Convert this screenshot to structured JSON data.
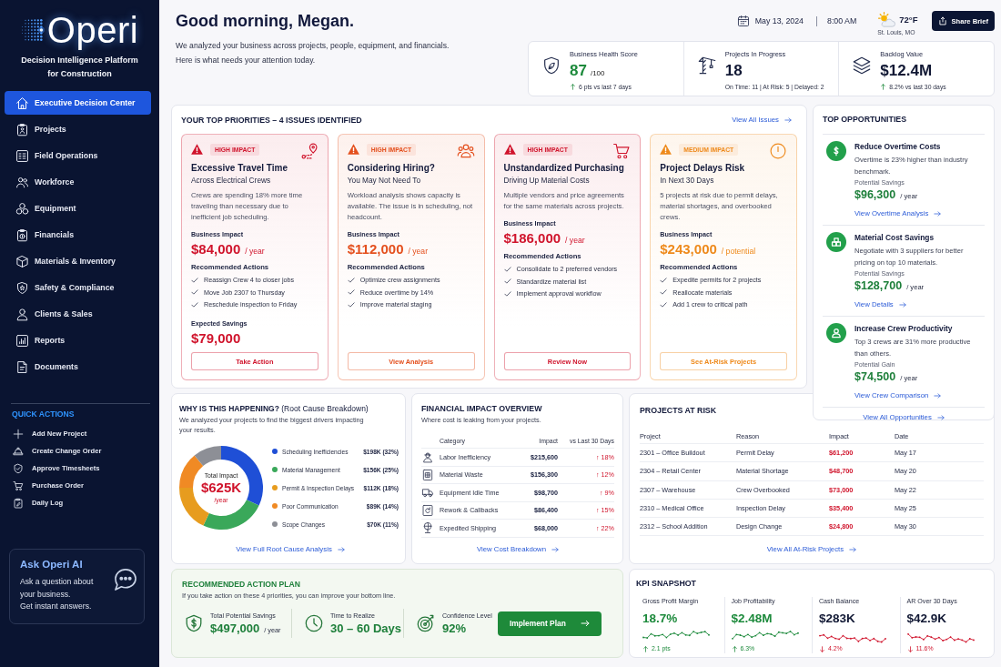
{
  "sidebar": {
    "brand": "Operi",
    "tagline": "Decision Intelligence Platform for Construction",
    "nav": [
      {
        "label": "Executive Decision Center",
        "selected": true
      },
      {
        "label": "Projects",
        "selected": false
      },
      {
        "label": "Field Operations",
        "selected": false
      },
      {
        "label": "Workforce",
        "selected": false
      },
      {
        "label": "Equipment",
        "selected": false
      },
      {
        "label": "Financials",
        "selected": false
      },
      {
        "label": "Materials & Inventory",
        "selected": false
      },
      {
        "label": "Safety & Compliance",
        "selected": false
      },
      {
        "label": "Clients & Sales",
        "selected": false
      },
      {
        "label": "Reports",
        "selected": false
      },
      {
        "label": "Documents",
        "selected": false
      }
    ],
    "quick_actions_title": "QUICK ACTIONS",
    "quick_actions": [
      "Add New Project",
      "Create Change Order",
      "Approve Timesheets",
      "Purchase Order",
      "Daily Log"
    ],
    "assistant": {
      "title": "Ask Operi AI",
      "text": "Ask a question about your business.",
      "subtext": "Get instant answers."
    }
  },
  "header": {
    "greeting": "Good morning, Megan.",
    "intro": [
      "We analyzed your business across projects, people, equipment, and financials.",
      "Here is what needs your attention today."
    ],
    "date": "May 13, 2024",
    "time": "8:00 AM",
    "weather": {
      "temperature": "72°F",
      "location": "St. Louis, MO"
    },
    "share_button": "Share Brief"
  },
  "summary": [
    {
      "label": "Business Health Score",
      "value": "87",
      "unit": "/100",
      "highlight": true,
      "rising": true,
      "note": "6 pts vs last 7 days"
    },
    {
      "label": "Projects In Progress",
      "value": "18",
      "highlight": false,
      "note": "On Time: 11 | At Risk: 5 | Delayed: 2"
    },
    {
      "label": "Backlog Value",
      "value": "$12.4M",
      "highlight": false,
      "rising": true,
      "note": "8.2% vs last 30 days"
    }
  ],
  "priorities": {
    "title": "YOUR TOP PRIORITIES – 4 ISSUES IDENTIFIED",
    "link": "View All Issues",
    "cards": [
      {
        "impact": "HIGH IMPACT",
        "color": "#d0142c",
        "title": "Excessive Travel Time",
        "subtitle": "Across Electrical Crews",
        "description": "Crews are spending 18% more time traveling than necessary due to inefficient job scheduling.",
        "impact_label": "Business Impact",
        "amount": "$84,000",
        "period": "/ year",
        "actions_title": "Recommended Actions",
        "actions": [
          "Reassign Crew 4 to closer jobs",
          "Move Job 2307 to Thursday",
          "Reschedule inspection to Friday"
        ],
        "savings": {
          "label": "Expected Savings",
          "amount": "$79,000"
        },
        "button": "Take Action"
      },
      {
        "impact": "HIGH IMPACT",
        "color": "#e4501e",
        "title": "Considering Hiring?",
        "subtitle": "You May Not Need To",
        "description": "Workload analysis shows capacity is available. The issue is in scheduling, not headcount.",
        "impact_label": "Business Impact",
        "amount": "$112,000",
        "period": "/ year",
        "actions_title": "Recommended Actions",
        "actions": [
          "Optimize crew assignments",
          "Reduce overtime by 14%",
          "Improve material staging"
        ],
        "button": "View Analysis"
      },
      {
        "impact": "HIGH IMPACT",
        "color": "#d0142c",
        "title": "Unstandardized Purchasing",
        "subtitle": "Driving Up Material Costs",
        "description": "Multiple vendors and price agreements for the same materials across projects.",
        "impact_label": "Business Impact",
        "amount": "$186,000",
        "period": "/ year",
        "actions_title": "Recommended Actions",
        "actions": [
          "Consolidate to 2 preferred vendors",
          "Standardize material list",
          "Implement approval workflow"
        ],
        "button": "Review Now"
      },
      {
        "impact": "MEDIUM IMPACT",
        "color": "#ee8a1c",
        "title": "Project Delays Risk",
        "subtitle": "In Next 30 Days",
        "description": "5 projects at risk due to permit delays, material shortages, and overbooked crews.",
        "impact_label": "Business Impact",
        "amount": "$243,000",
        "period": "/ potential",
        "actions_title": "Recommended Actions",
        "actions": [
          "Expedite permits for 2 projects",
          "Reallocate materials",
          "Add 1 crew to critical path"
        ],
        "button": "See At-Risk Projects"
      }
    ]
  },
  "opportunities": {
    "title": "TOP OPPORTUNITIES",
    "items": [
      {
        "title": "Reduce Overtime Costs",
        "description": "Overtime is 23% higher than industry benchmark.",
        "metric_label": "Potential Savings",
        "amount": "$96,300",
        "period": "/ year",
        "link": "View Overtime Analysis"
      },
      {
        "title": "Material Cost Savings",
        "description": "Negotiate with 3 suppliers for better pricing on top 10 materials.",
        "metric_label": "Potential Savings",
        "amount": "$128,700",
        "period": "/ year",
        "link": "View Details"
      },
      {
        "title": "Increase Crew Productivity",
        "description": "Top 3 crews are 31% more productive than others.",
        "metric_label": "Potential Gain",
        "amount": "$74,500",
        "period": "/ year",
        "link": "View Crew Comparison"
      }
    ],
    "link": "View All Opportunities"
  },
  "root_cause": {
    "title": "**WHY IS THIS HAPPENING?** (Root Cause Breakdown)",
    "description": "We analyzed your projects to find the biggest drivers impacting your results.",
    "total": {
      "label": "Total Impact",
      "value": "$625K",
      "unit": "/year"
    },
    "chart_data": {
      "type": "donut",
      "categories": [
        "Scheduling Inefficiencies",
        "Material Management",
        "Permit & Inspection Delays",
        "Poor Communication",
        "Scope Changes"
      ],
      "values": [
        32,
        25,
        18,
        14,
        11
      ],
      "colors": [
        "#1f4fd6",
        "#3aa85a",
        "#e79c1e",
        "#f08a24",
        "#8d8f96"
      ],
      "value_labels": [
        "$198K (32%)",
        "$156K (25%)",
        "$112K (18%)",
        "$89K (14%)",
        "$70K (11%)"
      ],
      "legend": "right"
    },
    "link": "View Full Root Cause Analysis"
  },
  "financial_impact": {
    "title": "FINANCIAL IMPACT OVERVIEW",
    "description": "Where cost is leaking from your projects.",
    "columns": [
      "Category",
      "Impact",
      "vs Last 30 Days"
    ],
    "rows": [
      {
        "category": "Labor Inefficiency",
        "impact": "$215,600",
        "change": "↑ 18%"
      },
      {
        "category": "Material Waste",
        "impact": "$156,300",
        "change": "↑ 12%"
      },
      {
        "category": "Equipment Idle Time",
        "impact": "$98,700",
        "change": "↑ 9%"
      },
      {
        "category": "Rework & Callbacks",
        "impact": "$86,400",
        "change": "↑ 15%"
      },
      {
        "category": "Expedited Shipping",
        "impact": "$68,000",
        "change": "↑ 22%"
      }
    ],
    "link": "View Cost Breakdown"
  },
  "projects_at_risk": {
    "title": "PROJECTS AT RISK",
    "columns": [
      "Project",
      "Reason",
      "Impact",
      "Date"
    ],
    "rows": [
      [
        "2301 – Office Buildout",
        "Permit Delay",
        "$61,200",
        "May 17"
      ],
      [
        "2304 – Retail Center",
        "Material Shortage",
        "$48,700",
        "May 20"
      ],
      [
        "2307 – Warehouse",
        "Crew Overbooked",
        "$73,000",
        "May 22"
      ],
      [
        "2310 – Medical Office",
        "Inspection Delay",
        "$35,400",
        "May 25"
      ],
      [
        "2312 – School Addition",
        "Design Change",
        "$24,800",
        "May 30"
      ]
    ],
    "link": "View All At-Risk Projects"
  },
  "action_plan": {
    "title": "RECOMMENDED ACTION PLAN",
    "description": "If you take action on these 4 priorities, you can improve your bottom line.",
    "metrics": [
      {
        "label": "Total Potential Savings",
        "value": "$497,000",
        "unit": "/ year"
      },
      {
        "label": "Time to Realize",
        "value": "30 – 60 Days"
      },
      {
        "label": "Confidence Level",
        "value": "92%"
      }
    ],
    "button": "Implement Plan"
  },
  "kpi_snapshot": {
    "title": "KPI SNAPSHOT",
    "items": [
      {
        "label": "Gross Profit Margin",
        "value": "18.7%",
        "change": "2.1 pts",
        "rising": true
      },
      {
        "label": "Job Profitability",
        "value": "$2.48M",
        "change": "6.3%",
        "rising": true
      },
      {
        "label": "Cash Balance",
        "value": "$283K",
        "change": "4.2%",
        "rising": false
      },
      {
        "label": "AR Over 30 Days",
        "value": "$42.9K",
        "change": "11.6%",
        "rising": false
      }
    ]
  }
}
